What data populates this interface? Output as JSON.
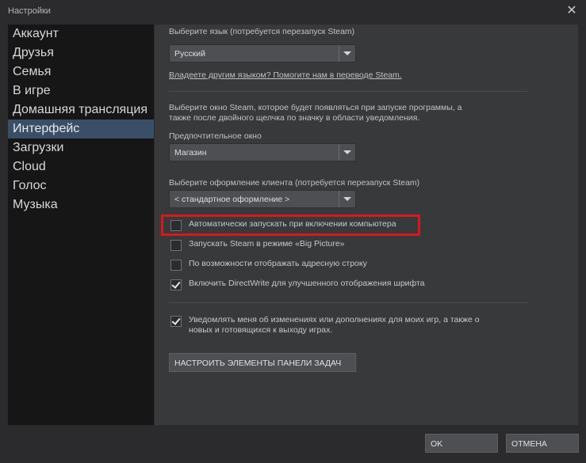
{
  "window": {
    "title": "Настройки",
    "close_glyph": "✕"
  },
  "sidebar": {
    "items": [
      {
        "label": "Аккаунт"
      },
      {
        "label": "Друзья"
      },
      {
        "label": "Семья"
      },
      {
        "label": "В игре"
      },
      {
        "label": "Домашняя трансляция"
      },
      {
        "label": "Интерфейс"
      },
      {
        "label": "Загрузки"
      },
      {
        "label": "Cloud"
      },
      {
        "label": "Голос"
      },
      {
        "label": "Музыка"
      }
    ],
    "active_index": 5
  },
  "interface": {
    "language_label": "Выберите язык (потребуется перезапуск Steam)",
    "language_value": "Русский",
    "translate_link": "Владеете другим языком? Помогите нам в переводе Steam.",
    "window_desc_line1": "Выберите окно Steam, которое будет появляться при запуске программы, а",
    "window_desc_line2": "также после двойного щелчка по значку в области уведомления.",
    "preferred_window_label": "Предпочтительное окно",
    "preferred_window_value": "Магазин",
    "skin_label": "Выберите оформление клиента (потребуется перезапуск Steam)",
    "skin_value": "< стандартное оформление >",
    "checkboxes": [
      {
        "label": "Автоматически запускать при включении компьютера",
        "checked": false
      },
      {
        "label": "Запускать Steam в режиме «Big Picture»",
        "checked": false
      },
      {
        "label": "По возможности отображать адресную строку",
        "checked": false
      },
      {
        "label": "Включить DirectWrite для улучшенного отображения шрифта",
        "checked": true
      }
    ],
    "notify": {
      "line1": "Уведомлять меня об изменениях или дополнениях для моих игр, а также о",
      "line2": "новых и готовящихся к выходу играх.",
      "checked": true
    },
    "taskbar_button": "НАСТРОИТЬ ЭЛЕМЕНТЫ ПАНЕЛИ ЗАДАЧ"
  },
  "footer": {
    "ok": "OK",
    "cancel": "ОТМЕНА"
  },
  "colors": {
    "highlight": "#d8181f",
    "active_item": "#3a4e68"
  }
}
